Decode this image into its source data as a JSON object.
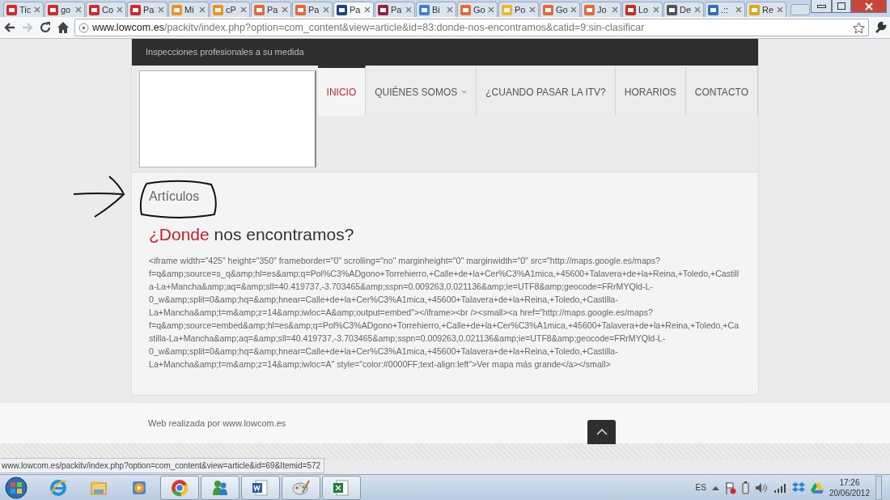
{
  "browser": {
    "tabs": [
      {
        "label": "Tic",
        "color": "#d9262b",
        "selected": false
      },
      {
        "label": "go",
        "color": "#d9262b",
        "selected": false
      },
      {
        "label": "Co",
        "color": "#d9262b",
        "selected": false
      },
      {
        "label": "Pa",
        "color": "#d9262b",
        "selected": false
      },
      {
        "label": "Mi",
        "color": "#f0931e",
        "selected": false
      },
      {
        "label": "cP",
        "color": "#f0931e",
        "selected": false
      },
      {
        "label": "Pa",
        "color": "#e8683a",
        "selected": false
      },
      {
        "label": "Pa",
        "color": "#e8683a",
        "selected": false
      },
      {
        "label": "Pa",
        "color": "#1f3f8f",
        "selected": true
      },
      {
        "label": "Pa",
        "color": "#9b2140",
        "selected": false
      },
      {
        "label": "Bi",
        "color": "#3b82d9",
        "selected": false
      },
      {
        "label": "Go",
        "color": "#e8683a",
        "selected": false
      },
      {
        "label": "Po",
        "color": "#f2b430",
        "selected": false
      },
      {
        "label": "Go",
        "color": "#e8683a",
        "selected": false
      },
      {
        "label": "Jo",
        "color": "#e8683a",
        "selected": false
      },
      {
        "label": "Lo",
        "color": "#cc2a1e",
        "selected": false
      },
      {
        "label": "De",
        "color": "#555555",
        "selected": false
      },
      {
        "label": ".::",
        "color": "#2f6fc2",
        "selected": false
      },
      {
        "label": "Re",
        "color": "#e0a810",
        "selected": false
      }
    ],
    "address": {
      "host": "www.lowcom.es",
      "path": "/packitv/index.php?option=com_content&view=article&id=83:donde-nos-encontramos&catid=9:sin-clasificar"
    },
    "forward_disabled": true,
    "status_link": "www.lowcom.es/packitv/index.php?option=com_content&view=article&id=69&Itemid=572"
  },
  "site": {
    "tagline": "Inspecciones profesionales a su medida",
    "nav": [
      {
        "label": "INICIO",
        "selected": true,
        "dropdown": false
      },
      {
        "label": "QUIÉNES SOMOS",
        "selected": false,
        "dropdown": true
      },
      {
        "label": "¿CUANDO PASAR LA ITV?",
        "selected": false,
        "dropdown": false
      },
      {
        "label": "HORARIOS",
        "selected": false,
        "dropdown": false
      },
      {
        "label": "CONTACTO",
        "selected": false,
        "dropdown": false
      }
    ],
    "category": "Artículos",
    "title": {
      "highlight": "¿Donde",
      "rest": "nos encontramos?"
    },
    "body": "<iframe width=\"425\" height=\"350\" frameborder=\"0\" scrolling=\"no\" marginheight=\"0\" marginwidth=\"0\" src=\"http://maps.google.es/maps?f=q&amp;source=s_q&amp;hl=es&amp;q=Pol%C3%ADgono+Torrehierro,+Calle+de+la+Cer%C3%A1mica,+45600+Talavera+de+la+Reina,+Toledo,+Castilla-La+Mancha&amp;aq=&amp;sll=40.419737,-3.703465&amp;sspn=0.009263,0.021136&amp;ie=UTF8&amp;geocode=FRrMYQld-L-0_w&amp;split=0&amp;hq=&amp;hnear=Calle+de+la+Cer%C3%A1mica,+45600+Talavera+de+la+Reina,+Toledo,+Castilla-La+Mancha&amp;t=m&amp;z=14&amp;iwloc=A&amp;output=embed\"></iframe><br /><small><a href=\"http://maps.google.es/maps?f=q&amp;source=embed&amp;hl=es&amp;q=Pol%C3%ADgono+Torrehierro,+Calle+de+la+Cer%C3%A1mica,+45600+Talavera+de+la+Reina,+Toledo,+Castilla-La+Mancha&amp;aq=&amp;sll=40.419737,-3.703465&amp;sspn=0.009263,0.021136&amp;ie=UTF8&amp;geocode=FRrMYQld-L-0_w&amp;split=0&amp;hq=&amp;hnear=Calle+de+la+Cer%C3%A1mica,+45600+Talavera+de+la+Reina,+Toledo,+Castilla-La+Mancha&amp;t=m&amp;z=14&amp;iwloc=A\" style=\"color:#0000FF;text-align:left\">Ver mapa más grande</a></small>",
    "footer": "Web realizada por www.lowcom.es"
  },
  "taskbar": {
    "apps": [
      {
        "kind": "ie",
        "running": false
      },
      {
        "kind": "folder",
        "running": false
      },
      {
        "kind": "media",
        "running": false
      },
      {
        "kind": "chrome",
        "running": true
      },
      {
        "kind": "messenger",
        "running": true
      },
      {
        "kind": "word",
        "running": true
      },
      {
        "kind": "paint",
        "running": true
      },
      {
        "kind": "excel",
        "running": true
      }
    ],
    "language": "ES",
    "time": "17:26",
    "date": "20/06/2012"
  }
}
